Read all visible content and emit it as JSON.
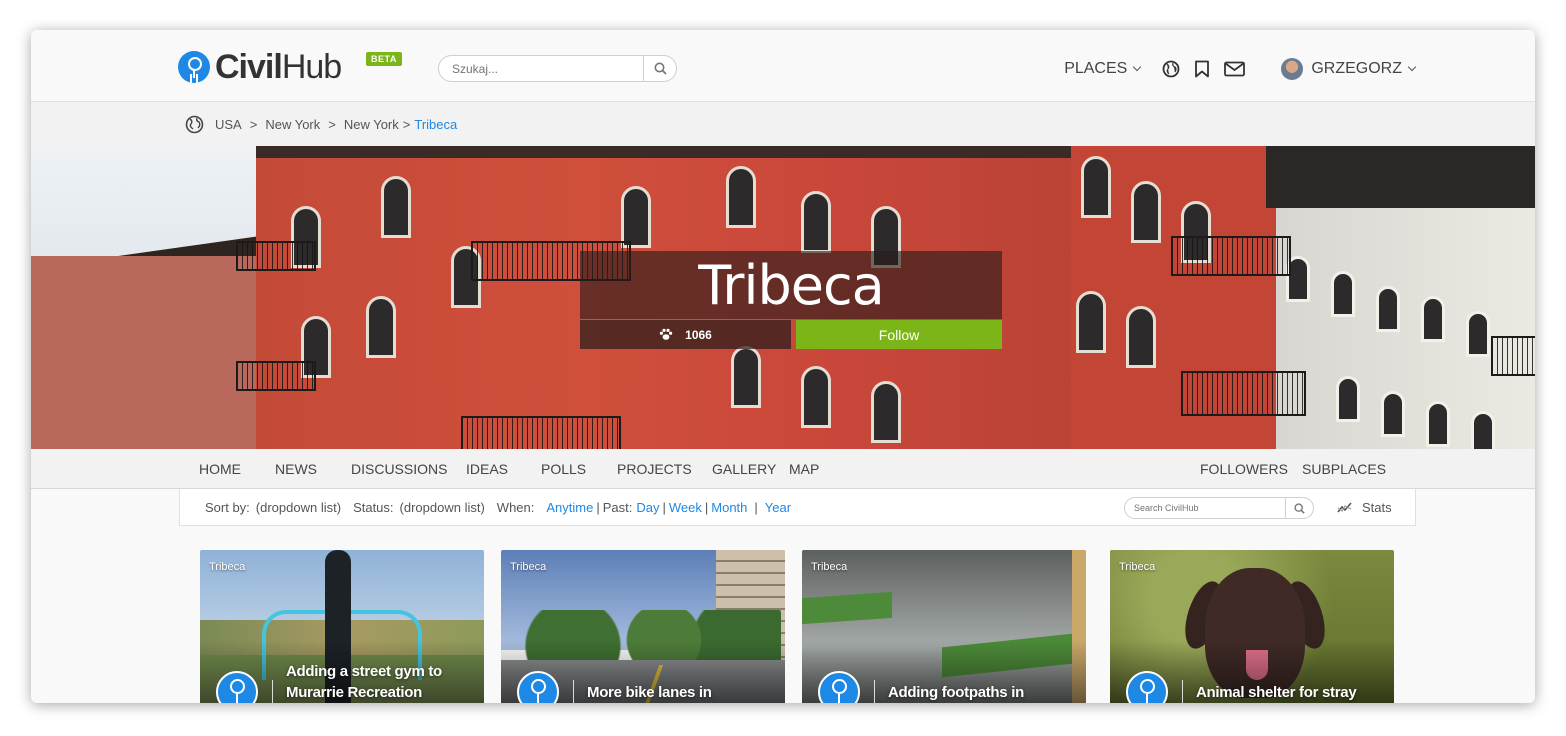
{
  "header": {
    "logo_civil": "Civil",
    "logo_hub": "Hub",
    "beta_label": "BETA",
    "search_placeholder": "Szukaj...",
    "places_label": "PLACES",
    "user_name": "GRZEGORZ"
  },
  "breadcrumb": {
    "items": [
      "USA",
      "New York",
      "New York"
    ],
    "separator": ">",
    "current": "Tribeca"
  },
  "hero": {
    "title": "Tribeca",
    "followers_count": "1066",
    "follow_label": "Follow"
  },
  "tabs": {
    "left": [
      "HOME",
      "NEWS",
      "DISCUSSIONS",
      "IDEAS",
      "POLLS",
      "PROJECTS",
      "GALLERY",
      "MAP"
    ],
    "right": [
      "FOLLOWERS",
      "SUBPLACES"
    ]
  },
  "filters": {
    "sort_label": "Sort by:",
    "sort_value": "(dropdown list)",
    "status_label": "Status:",
    "status_value": "(dropdown list)",
    "when_label": "When:",
    "anytime": "Anytime",
    "past_label": "Past:",
    "day": "Day",
    "week": "Week",
    "month": "Month",
    "year": "Year",
    "pipe": "|",
    "search_placeholder": "Search CivilHub",
    "stats_label": "Stats"
  },
  "cards": [
    {
      "tag": "Tribeca",
      "title": "Adding a street gym to Murarrie Recreation"
    },
    {
      "tag": "Tribeca",
      "title": "More bike lanes in"
    },
    {
      "tag": "Tribeca",
      "title": "Adding footpaths in"
    },
    {
      "tag": "Tribeca",
      "title": "Animal shelter for stray"
    }
  ],
  "colors": {
    "accent_blue": "#1e88e5",
    "follow_green": "#7cb518",
    "beta_green": "#7cb518"
  }
}
